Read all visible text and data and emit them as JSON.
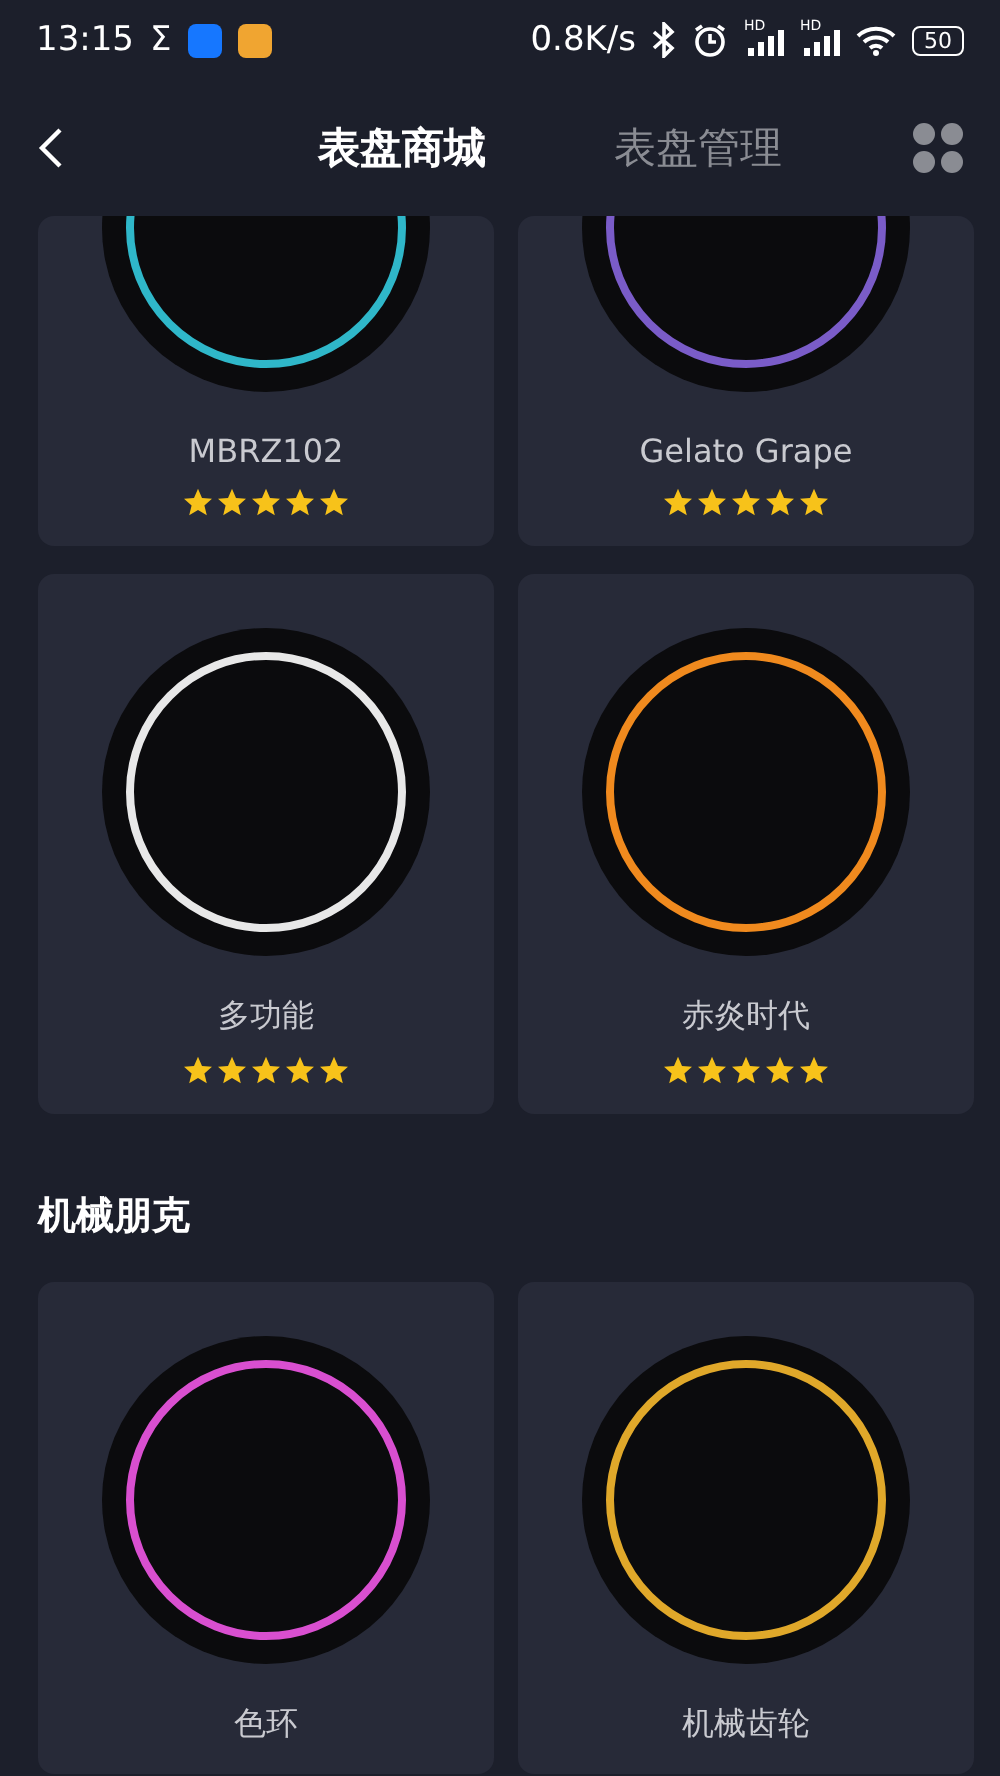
{
  "status_bar": {
    "time": "13:15",
    "sigma": "Σ",
    "speed": "0.8K/s",
    "signals": [
      "HD",
      "HD"
    ],
    "battery": "50"
  },
  "header": {
    "tabs": [
      {
        "label": "表盘商城",
        "selected": true
      },
      {
        "label": "表盘管理",
        "selected": false
      }
    ]
  },
  "sections": [
    {
      "faces": [
        {
          "name": "MBRZ102",
          "stars": 5,
          "color": "#2fb7c9"
        },
        {
          "name": "Gelato Grape",
          "stars": 5,
          "color": "#7a5cc8"
        }
      ]
    },
    {
      "faces": [
        {
          "name": "多功能",
          "stars": 5,
          "color": "#e8e8e8"
        },
        {
          "name": "赤炎时代",
          "stars": 5,
          "color": "#f08a1e"
        }
      ]
    },
    {
      "title": "机械朋克",
      "faces": [
        {
          "name": "色环",
          "color": "#d94fd0"
        },
        {
          "name": "机械齿轮",
          "color": "#e0a82a"
        }
      ]
    }
  ]
}
